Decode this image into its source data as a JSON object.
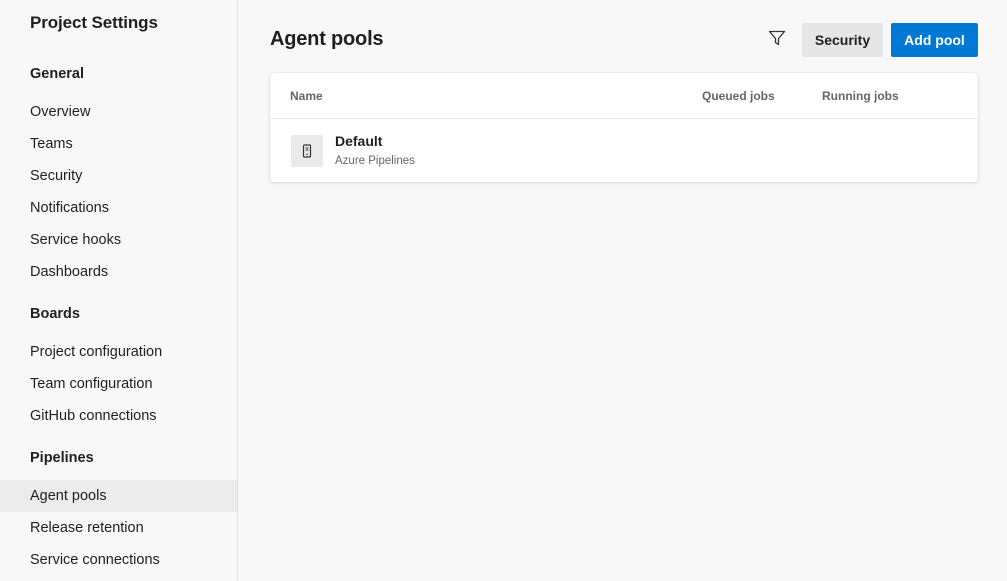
{
  "sidebar": {
    "title": "Project Settings",
    "sections": [
      {
        "heading": "General",
        "items": [
          "Overview",
          "Teams",
          "Security",
          "Notifications",
          "Service hooks",
          "Dashboards"
        ]
      },
      {
        "heading": "Boards",
        "items": [
          "Project configuration",
          "Team configuration",
          "GitHub connections"
        ]
      },
      {
        "heading": "Pipelines",
        "items": [
          "Agent pools",
          "Release retention",
          "Service connections"
        ]
      }
    ],
    "selected_item": "Agent pools"
  },
  "main": {
    "title": "Agent pools",
    "toolbar": {
      "filter_icon": "filter-icon",
      "security_label": "Security",
      "add_label": "Add pool"
    },
    "table": {
      "columns": [
        "Name",
        "Queued jobs",
        "Running jobs"
      ],
      "rows": [
        {
          "icon": "agent-pool-icon",
          "name": "Default",
          "subtitle": "Azure Pipelines",
          "queued": "",
          "running": ""
        }
      ]
    }
  },
  "colors": {
    "accent": "#0078d4",
    "selected_bg": "#ececec",
    "page_bg": "#f8f8f8"
  }
}
